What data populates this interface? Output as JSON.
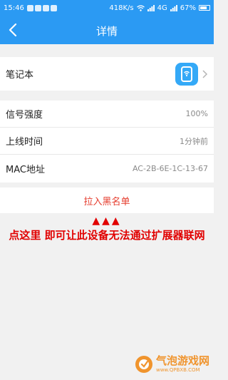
{
  "status_bar": {
    "time": "15:46",
    "speed": "418K/s",
    "network": "4G",
    "battery": "67%"
  },
  "nav": {
    "title": "详情",
    "back_icon": "chevron-left-icon"
  },
  "device": {
    "name": "笔记本",
    "icon": "phone-wifi-icon",
    "icon_color": "#34a9f7"
  },
  "info": [
    {
      "label": "信号强度",
      "value": "100%"
    },
    {
      "label": "上线时间",
      "value": "1分钟前"
    },
    {
      "label": "MAC地址",
      "value": "AC-2B-6E-1C-13-67"
    }
  ],
  "blacklist": {
    "label": "拉入黑名单",
    "color": "#e53b2c"
  },
  "annotation": {
    "arrows": "▲▲▲",
    "text": "点这里 即可让此设备无法通过扩展器联网",
    "color": "#e10000"
  },
  "watermark": {
    "title": "气泡游戏网",
    "url": "www.QPBXB.COM"
  },
  "colors": {
    "primary": "#2b9af3",
    "background": "#f1f1f1"
  }
}
